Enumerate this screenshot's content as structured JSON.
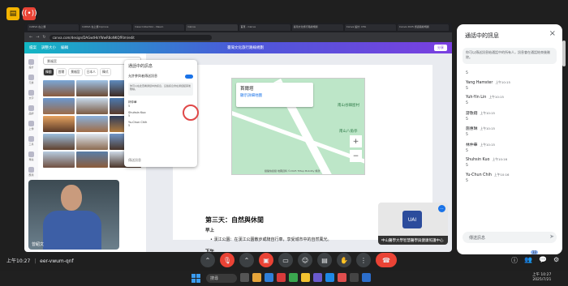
{
  "app": {
    "top_icons": [
      "document-icon",
      "broadcast-icon"
    ]
  },
  "browser": {
    "tabs": [
      "CANVA 在上課",
      "CANVA 在上課 Inprove",
      "Case Collection - Neuro",
      "Canva",
      "首頁 - Canva",
      "臺灣文化旅行路線規劃",
      "Canva 設計: OTA",
      "Canva 2025 旅遊路線規劃"
    ],
    "url": "canva.com/design/DAGwtHkYWwR8oNKQfRlm/edit"
  },
  "canva": {
    "menu": [
      "檔案",
      "調整大小",
      "編輯"
    ],
    "doc_title": "臺灣文化旅行路線規劃",
    "share_label": "分享",
    "search_placeholder": "景福宮",
    "filters": [
      "韓國",
      "首爾",
      "景福宮",
      "日本人",
      "韓式"
    ],
    "sidebar_labels": [
      "設計",
      "元素",
      "文字",
      "品牌",
      "上傳",
      "工具",
      "專案",
      "應用"
    ]
  },
  "map": {
    "title": "首爾塔",
    "link": "顯示詳細地圖",
    "labels": [
      "南山谷韓屋村",
      "南山八角亭"
    ],
    "copyright": "鍵盤快捷鍵  地圖資料 ©2025 TMap Mobility  條款",
    "zoom_in": "+",
    "zoom_out": "−"
  },
  "doc": {
    "heading": "第三天：自然與休閒",
    "morning": "早上",
    "bullet": "•  漢江公園：在漢江公園散步或騎自行車，享受城市中的自然風光。",
    "afternoon": "下午"
  },
  "inner_chat": {
    "title": "通話中的訊息",
    "toggle_label": "允許參與者傳送訊息",
    "note": "你可以在此查看通話中的訊息，這些訊息會在通話結束後刪除。",
    "messages": [
      {
        "name": "林仲華",
        "time": "上午10:15",
        "text": "5"
      },
      {
        "name": "Shuhsin Kuo",
        "time": "上午10:16",
        "text": "5"
      },
      {
        "name": "Yu-Chun Chih",
        "time": "上午10:16",
        "text": "5"
      }
    ],
    "input_placeholder": "傳送訊息"
  },
  "speaker": {
    "name": "曾紹文"
  },
  "self_tile": {
    "logo_text": "UAI",
    "caption": "中山醫學大學智慧醫學與健康照護中心"
  },
  "chat": {
    "title": "通話中的訊息",
    "close": "×",
    "info": "你可以傳送訊息給通話中的所有人，訊息會在通話結束後刪除。",
    "messages": [
      {
        "name": "Yang Hamster",
        "time": "上午10:15",
        "text": "5"
      },
      {
        "name": "Yuh-Yin Lin",
        "time": "上午10:15",
        "text": "5"
      },
      {
        "name": "游敦翔",
        "time": "上午10:15",
        "text": "5"
      },
      {
        "name": "施惠琳",
        "time": "上午10:15",
        "text": "5"
      },
      {
        "name": "林仲華",
        "time": "上午10:15",
        "text": "5"
      },
      {
        "name": "Shuhsin Kuo",
        "time": "上午10:16",
        "text": "5"
      },
      {
        "name": "Yu-Chun Chih",
        "time": "上午10:16",
        "text": "5"
      }
    ],
    "partial_first": "5",
    "input_placeholder": "傳送訊息"
  },
  "meeting": {
    "time": "上午10:27",
    "code": "eer-vwum-qnf",
    "participants_badge": "33"
  },
  "taskbar": {
    "search": "搜尋",
    "clock_time": "上午 10:27",
    "clock_date": "2025/7/21"
  },
  "colors": {
    "end_call": "#ea4335",
    "canva_gradient_start": "#12b7c4",
    "canva_gradient_end": "#7a3fe0",
    "link": "#1a73e8"
  }
}
